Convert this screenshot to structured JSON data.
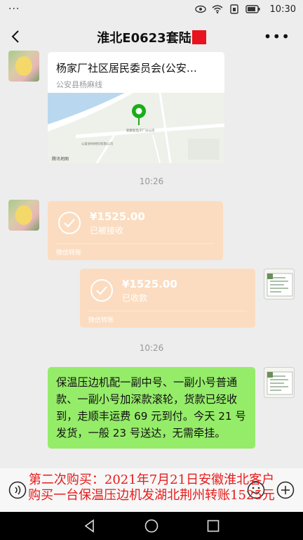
{
  "status_bar": {
    "dots": "···",
    "time": "10:30"
  },
  "header": {
    "title": "淮北E0623套陆"
  },
  "messages": {
    "location": {
      "name": "杨家厂社区居民委员会(公安…",
      "address": "公安县杨麻线",
      "map_labels": [
        "公安县绿材料有限公司",
        "新鹏程电子厂分公司",
        "腾讯地图"
      ]
    },
    "time1": "10:26",
    "transfer_in": {
      "amount": "¥1525.00",
      "status": "已被接收",
      "footer": "微信转账"
    },
    "transfer_out": {
      "amount": "¥1525.00",
      "status": "已收款",
      "footer": "微信转账"
    },
    "time2": "10:26",
    "text_message": "保温压边机配一副中号、一副小号普通款、一副小号加深款滚轮，货款已经收到，走顺丰运费 69 元到付。今天 21 号发货，一般 23 号送达，无需牵挂。"
  },
  "caption": {
    "line1": "第二次购买：2021年7月21日安徽淮北客户",
    "line2": "购买一台保温压边机发湖北荆州转账1525元"
  },
  "colors": {
    "bubble_green": "#95ec69",
    "transfer_received": "#fbdcc0",
    "caption_red": "#e81b1b"
  },
  "icons": [
    "back-icon",
    "more-icon",
    "check-circle-icon",
    "voice-icon",
    "emoji-icon",
    "plus-icon",
    "nav-back-icon",
    "nav-home-icon",
    "nav-recent-icon"
  ]
}
